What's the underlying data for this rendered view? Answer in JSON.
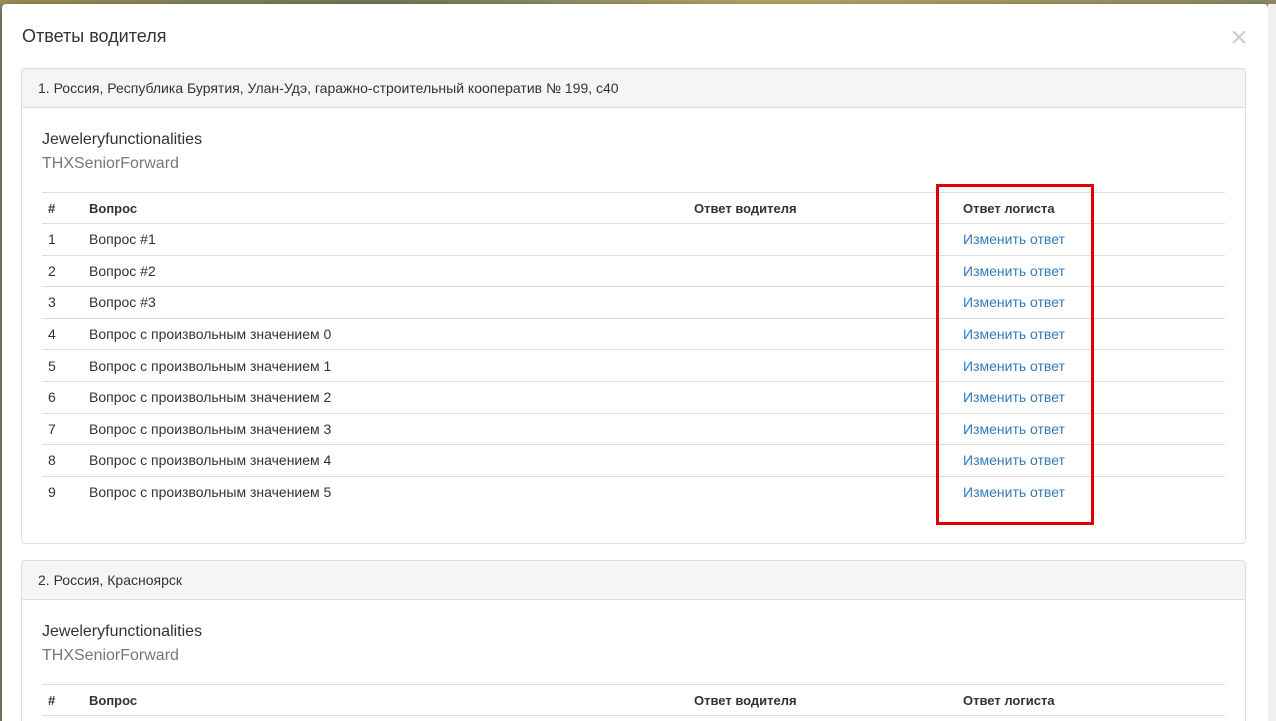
{
  "modal": {
    "title": "Ответы водителя",
    "close_glyph": "×"
  },
  "table_headers": {
    "num": "#",
    "question": "Вопрос",
    "driver_answer": "Ответ водителя",
    "logist_answer": "Ответ логиста"
  },
  "panels": [
    {
      "heading": "1. Россия, Республика Бурятия, Улан-Удэ, гаражно-строительный кооператив № 199, с40",
      "driver_name": "Jeweleryfunctionalities",
      "driver_sub": "THXSeniorForward",
      "rows": [
        {
          "num": "1",
          "question": "Вопрос #1",
          "driver_answer": "",
          "action": "Изменить ответ"
        },
        {
          "num": "2",
          "question": "Вопрос #2",
          "driver_answer": "",
          "action": "Изменить ответ"
        },
        {
          "num": "3",
          "question": "Вопрос #3",
          "driver_answer": "",
          "action": "Изменить ответ"
        },
        {
          "num": "4",
          "question": "Вопрос с произвольным значением 0",
          "driver_answer": "",
          "action": "Изменить ответ"
        },
        {
          "num": "5",
          "question": "Вопрос с произвольным значением 1",
          "driver_answer": "",
          "action": "Изменить ответ"
        },
        {
          "num": "6",
          "question": "Вопрос с произвольным значением 2",
          "driver_answer": "",
          "action": "Изменить ответ"
        },
        {
          "num": "7",
          "question": "Вопрос с произвольным значением 3",
          "driver_answer": "",
          "action": "Изменить ответ"
        },
        {
          "num": "8",
          "question": "Вопрос с произвольным значением 4",
          "driver_answer": "",
          "action": "Изменить ответ"
        },
        {
          "num": "9",
          "question": "Вопрос с произвольным значением 5",
          "driver_answer": "",
          "action": "Изменить ответ"
        }
      ]
    },
    {
      "heading": "2. Россия, Красноярск",
      "driver_name": "Jeweleryfunctionalities",
      "driver_sub": "THXSeniorForward"
    }
  ],
  "colors": {
    "link": "#337ab7",
    "highlight": "#e00000",
    "panel_heading_bg": "#f5f5f5"
  }
}
